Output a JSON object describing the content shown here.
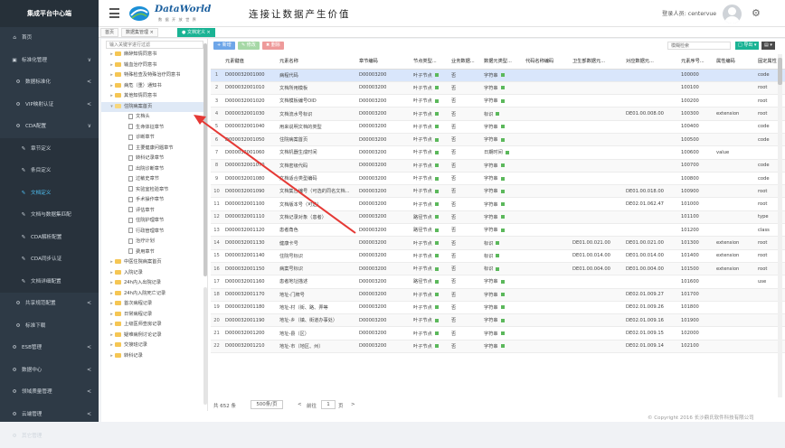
{
  "sidebar": {
    "brand": "集成平台中心端",
    "items": [
      {
        "label": "首页",
        "icon": "home-icon",
        "level": 0
      },
      {
        "label": "标准化管理",
        "icon": "sitemap-icon",
        "level": 0,
        "arrow": "∨"
      },
      {
        "label": "数据标准化",
        "icon": "gear-icon",
        "level": 1,
        "arrow": "<"
      },
      {
        "label": "VIP映射认证",
        "icon": "gear-icon",
        "level": 1,
        "arrow": "<"
      },
      {
        "label": "CDA配置",
        "icon": "gear-icon",
        "level": 1,
        "arrow": "∨"
      },
      {
        "label": "章节定义",
        "icon": "wrench-icon",
        "level": 2
      },
      {
        "label": "条目定义",
        "icon": "wrench-icon",
        "level": 2
      },
      {
        "label": "文档定义",
        "icon": "wrench-icon",
        "level": 2,
        "active": true
      },
      {
        "label": "文档与数据集匹配",
        "icon": "wrench-icon",
        "level": 2
      },
      {
        "label": "CDA解析配置",
        "icon": "wrench-icon",
        "level": 2
      },
      {
        "label": "CDA同步认证",
        "icon": "wrench-icon",
        "level": 2
      },
      {
        "label": "文档详细配置",
        "icon": "wrench-icon",
        "level": 2
      },
      {
        "label": "共享规范配置",
        "icon": "gear-icon",
        "level": 1,
        "arrow": "<"
      },
      {
        "label": "标准下载",
        "icon": "gear-icon",
        "level": 1
      },
      {
        "label": "ESB管理",
        "icon": "gear-icon",
        "level": 0,
        "arrow": "<"
      },
      {
        "label": "数据中心",
        "icon": "gear-icon",
        "level": 0,
        "arrow": "<"
      },
      {
        "label": "领域质量管理",
        "icon": "gear-icon",
        "level": 0,
        "arrow": "<"
      },
      {
        "label": "云端管理",
        "icon": "gear-icon",
        "level": 0,
        "arrow": "<"
      },
      {
        "label": "其它管理",
        "icon": "gear-icon",
        "level": 0
      }
    ]
  },
  "header": {
    "logo_name": "DataWorld",
    "logo_sub": "数 据 开 放 世 界",
    "slogan": "连接让数据产生价值",
    "login_label": "登录人员: centervue"
  },
  "tabs": [
    {
      "label": "首页",
      "active": false
    },
    {
      "label": "数据集管理 ×",
      "active": false
    },
    {
      "label": "● 文档定义 ×",
      "active": true
    }
  ],
  "tree": {
    "search_placeholder": "输入关键字进行过滤",
    "nodes": [
      {
        "label": "麻醉知情同意书",
        "level": 0,
        "type": "folder"
      },
      {
        "label": "输血治疗同意书",
        "level": 0,
        "type": "folder"
      },
      {
        "label": "特殊检查及特殊治疗同意书",
        "level": 0,
        "type": "folder"
      },
      {
        "label": "病危（重）通知书",
        "level": 0,
        "type": "folder"
      },
      {
        "label": "其他知情同意书",
        "level": 0,
        "type": "folder"
      },
      {
        "label": "住院病案首页",
        "level": 0,
        "type": "folder-open",
        "selected": true
      },
      {
        "label": "文档头",
        "level": 1,
        "type": "doc"
      },
      {
        "label": "生命体征章节",
        "level": 1,
        "type": "doc"
      },
      {
        "label": "诊断章节",
        "level": 1,
        "type": "doc"
      },
      {
        "label": "主要健康问题章节",
        "level": 1,
        "type": "doc"
      },
      {
        "label": "转科记录章节",
        "level": 1,
        "type": "doc"
      },
      {
        "label": "出院诊断章节",
        "level": 1,
        "type": "doc"
      },
      {
        "label": "过敏史章节",
        "level": 1,
        "type": "doc"
      },
      {
        "label": "实验室检验章节",
        "level": 1,
        "type": "doc"
      },
      {
        "label": "手术操作章节",
        "level": 1,
        "type": "doc"
      },
      {
        "label": "评估章节",
        "level": 1,
        "type": "doc"
      },
      {
        "label": "住院护理章节",
        "level": 1,
        "type": "doc"
      },
      {
        "label": "行政管理章节",
        "level": 1,
        "type": "doc"
      },
      {
        "label": "治疗计划",
        "level": 1,
        "type": "doc"
      },
      {
        "label": "费用章节",
        "level": 1,
        "type": "doc"
      },
      {
        "label": "中医住院病案首页",
        "level": 0,
        "type": "folder"
      },
      {
        "label": "入院记录",
        "level": 0,
        "type": "folder"
      },
      {
        "label": "24h内入出院记录",
        "level": 0,
        "type": "folder"
      },
      {
        "label": "24h内入院死亡记录",
        "level": 0,
        "type": "folder"
      },
      {
        "label": "首次病程记录",
        "level": 0,
        "type": "folder"
      },
      {
        "label": "日常病程记录",
        "level": 0,
        "type": "folder"
      },
      {
        "label": "上级医师查房记录",
        "level": 0,
        "type": "folder"
      },
      {
        "label": "疑难病例讨论记录",
        "level": 0,
        "type": "folder"
      },
      {
        "label": "交接班记录",
        "level": 0,
        "type": "folder"
      },
      {
        "label": "转科记录",
        "level": 0,
        "type": "folder"
      }
    ]
  },
  "toolbar": {
    "add_label": "+ 新增",
    "edit_label": "✎ 修改",
    "delete_label": "✖ 删除",
    "search_placeholder": "模糊检索",
    "export_label": "□ 导出 ▾",
    "tool_label": "▤ ▾"
  },
  "table": {
    "columns": [
      "",
      "元素键值",
      "元素名称",
      "章节编码",
      "节点类型...",
      "业务数据...",
      "数据元类型...",
      "代码名称编码",
      "卫生部数据元...",
      "对应数据元...",
      "元素序号...",
      "属性编码",
      "固定属性"
    ],
    "rows": [
      [
        "1",
        "D000032001000",
        "病程代码",
        "D00003200",
        "叶子节点",
        "否",
        "字符串",
        "",
        "",
        "",
        "100000",
        "",
        "code"
      ],
      [
        "2",
        "D000032001010",
        "文档所用模板",
        "D00003200",
        "叶子节点",
        "否",
        "字符串",
        "",
        "",
        "",
        "100100",
        "",
        "root"
      ],
      [
        "3",
        "D000032001020",
        "文档模板编号OID",
        "D00003200",
        "叶子节点",
        "否",
        "字符串",
        "",
        "",
        "",
        "100200",
        "",
        "root"
      ],
      [
        "4",
        "D000032001030",
        "文档流水号标识",
        "D00003200",
        "叶子节点",
        "否",
        "标识",
        "",
        "",
        "DE01.00.008.00",
        "100300",
        "extension",
        "root"
      ],
      [
        "5",
        "D000032001040",
        "用来说明文档的类型",
        "D00003200",
        "叶子节点",
        "否",
        "字符串",
        "",
        "",
        "",
        "100400",
        "",
        "code"
      ],
      [
        "6",
        "D000032001050",
        "住院病案首页",
        "D00003200",
        "叶子节点",
        "否",
        "字符串",
        "",
        "",
        "",
        "100500",
        "",
        "code"
      ],
      [
        "7",
        "D000032001060",
        "文档机器生成时间",
        "D00003200",
        "叶子节点",
        "否",
        "日期时间",
        "",
        "",
        "",
        "100600",
        "value",
        ""
      ],
      [
        "8",
        "D000032001070",
        "文档密级代码",
        "D00003200",
        "叶子节点",
        "否",
        "字符串",
        "",
        "",
        "",
        "100700",
        "",
        "code"
      ],
      [
        "9",
        "D000032001080",
        "文档适合类型编码",
        "D00003200",
        "叶子节点",
        "否",
        "字符串",
        "",
        "",
        "",
        "100800",
        "",
        "code"
      ],
      [
        "10",
        "D000032001090",
        "文档集合编号（可选的同名文档...",
        "D00003200",
        "叶子节点",
        "否",
        "字符串",
        "",
        "",
        "DE01.00.018.00",
        "100900",
        "",
        "root"
      ],
      [
        "11",
        "D000032001100",
        "文档版本号（可选）",
        "D00003200",
        "叶子节点",
        "否",
        "字符串",
        "",
        "",
        "DE02.01.062.47",
        "101000",
        "",
        "root"
      ],
      [
        "12",
        "D000032001110",
        "文档记录对象（患者）",
        "D00003200",
        "路径节点",
        "否",
        "字符串",
        "",
        "",
        "",
        "101100",
        "",
        "type"
      ],
      [
        "13",
        "D000032001120",
        "患者角色",
        "D00003200",
        "路径节点",
        "否",
        "字符串",
        "",
        "",
        "",
        "101200",
        "",
        "class"
      ],
      [
        "14",
        "D000032001130",
        "健康卡号",
        "D00003200",
        "叶子节点",
        "否",
        "标识",
        "",
        "DE01.00.021.00",
        "DE01.00.021.00",
        "101300",
        "extension",
        "root"
      ],
      [
        "15",
        "D000032001140",
        "住院号标识",
        "D00003200",
        "叶子节点",
        "否",
        "标识",
        "",
        "DE01.00.014.00",
        "DE01.00.014.00",
        "101400",
        "extension",
        "root"
      ],
      [
        "16",
        "D000032001150",
        "病案号标识",
        "D00003200",
        "叶子节点",
        "否",
        "标识",
        "",
        "DE01.00.004.00",
        "DE01.00.004.00",
        "101500",
        "extension",
        "root"
      ],
      [
        "17",
        "D000032001160",
        "患者地址描述",
        "D00003200",
        "路径节点",
        "否",
        "字符串",
        "",
        "",
        "",
        "101600",
        "",
        "use"
      ],
      [
        "18",
        "D000032001170",
        "地址-门牌号",
        "D00003200",
        "叶子节点",
        "否",
        "字符串",
        "",
        "",
        "DE02.01.009.27",
        "101700",
        "",
        ""
      ],
      [
        "19",
        "D000032001180",
        "地址-村（街、路、弄等",
        "D00003200",
        "叶子节点",
        "否",
        "字符串",
        "",
        "",
        "DE02.01.009.26",
        "101800",
        "",
        ""
      ],
      [
        "20",
        "D000032001190",
        "地址-乡（镇、街道办事处）",
        "D00003200",
        "叶子节点",
        "否",
        "字符串",
        "",
        "",
        "DE02.01.009.16",
        "101900",
        "",
        ""
      ],
      [
        "21",
        "D000032001200",
        "地址-县（区）",
        "D00003200",
        "叶子节点",
        "否",
        "字符串",
        "",
        "",
        "DE02.01.009.15",
        "102000",
        "",
        ""
      ],
      [
        "22",
        "D000032001210",
        "地址-市（地区、州）",
        "D00003200",
        "叶子节点",
        "否",
        "字符串",
        "",
        "",
        "DE02.01.009.14",
        "102100",
        "",
        ""
      ]
    ]
  },
  "pager": {
    "total": "共 652 条",
    "page_size": "500条/页",
    "prev": "<",
    "next": ">",
    "goto_prefix": "前往",
    "page": "1",
    "goto_suffix": "页"
  },
  "footer": "© Copyright 2016 长沙鼎氏软件科技有限公司"
}
